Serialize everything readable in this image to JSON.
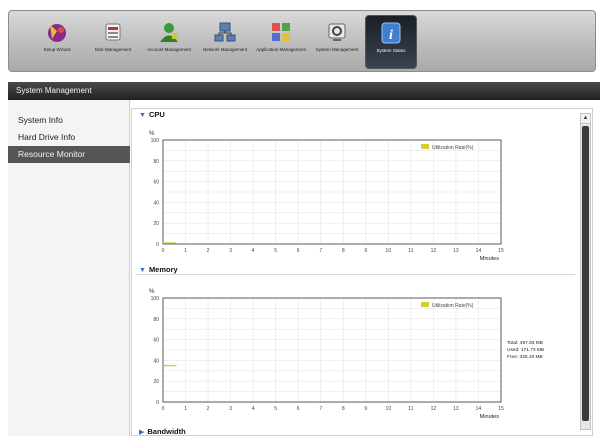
{
  "toolbar": {
    "items": [
      {
        "label": "Setup Wizard",
        "icon": "wizard-icon"
      },
      {
        "label": "Disk Management",
        "icon": "disk-icon"
      },
      {
        "label": "Account Management",
        "icon": "account-icon"
      },
      {
        "label": "Network Management",
        "icon": "network-icon"
      },
      {
        "label": "Application Management",
        "icon": "application-icon"
      },
      {
        "label": "System Management",
        "icon": "system-icon"
      },
      {
        "label": "System Status",
        "icon": "info-icon",
        "active": true
      }
    ]
  },
  "header": {
    "title": "System Management"
  },
  "sidebar": {
    "items": [
      {
        "label": "System Info",
        "active": false
      },
      {
        "label": "Hard Drive Info",
        "active": false
      },
      {
        "label": "Resource Monitor",
        "active": true
      }
    ]
  },
  "sections": {
    "cpu": {
      "title": "CPU"
    },
    "memory": {
      "title": "Memory"
    },
    "bandwidth": {
      "title": "Bandwidth"
    }
  },
  "memory_stats": {
    "total": "Total: 497.93 MB",
    "used": "Used: 171.73 MB",
    "free": "Free: 326.19 MB"
  },
  "colors": {
    "utilization_line": "#d4cc3a",
    "active_tool_bg": "#2a313b",
    "header_bg": "#2a2a2a"
  },
  "chart_data": [
    {
      "type": "line",
      "title": "CPU",
      "ylabel": "%",
      "xlabel": "Minutes",
      "ylim": [
        0,
        100
      ],
      "xlim": [
        0,
        15
      ],
      "yticks": [
        0,
        20,
        40,
        60,
        80,
        100
      ],
      "xticks": [
        0,
        1,
        2,
        3,
        4,
        5,
        6,
        7,
        8,
        9,
        10,
        11,
        12,
        13,
        14,
        15
      ],
      "grid": true,
      "legend_placement": "top-right",
      "series": [
        {
          "name": "Utilization Rate(%)",
          "x": [
            0,
            0.6
          ],
          "y": [
            1,
            1
          ],
          "color": "#d4cc3a"
        }
      ]
    },
    {
      "type": "line",
      "title": "Memory",
      "ylabel": "%",
      "xlabel": "Minutes",
      "ylim": [
        0,
        100
      ],
      "xlim": [
        0,
        15
      ],
      "yticks": [
        0,
        20,
        40,
        60,
        80,
        100
      ],
      "xticks": [
        0,
        1,
        2,
        3,
        4,
        5,
        6,
        7,
        8,
        9,
        10,
        11,
        12,
        13,
        14,
        15
      ],
      "grid": true,
      "legend_placement": "top-right",
      "series": [
        {
          "name": "Utilization Rate(%)",
          "x": [
            0,
            0.6
          ],
          "y": [
            35,
            35
          ],
          "color": "#d4cc3a"
        }
      ]
    }
  ]
}
